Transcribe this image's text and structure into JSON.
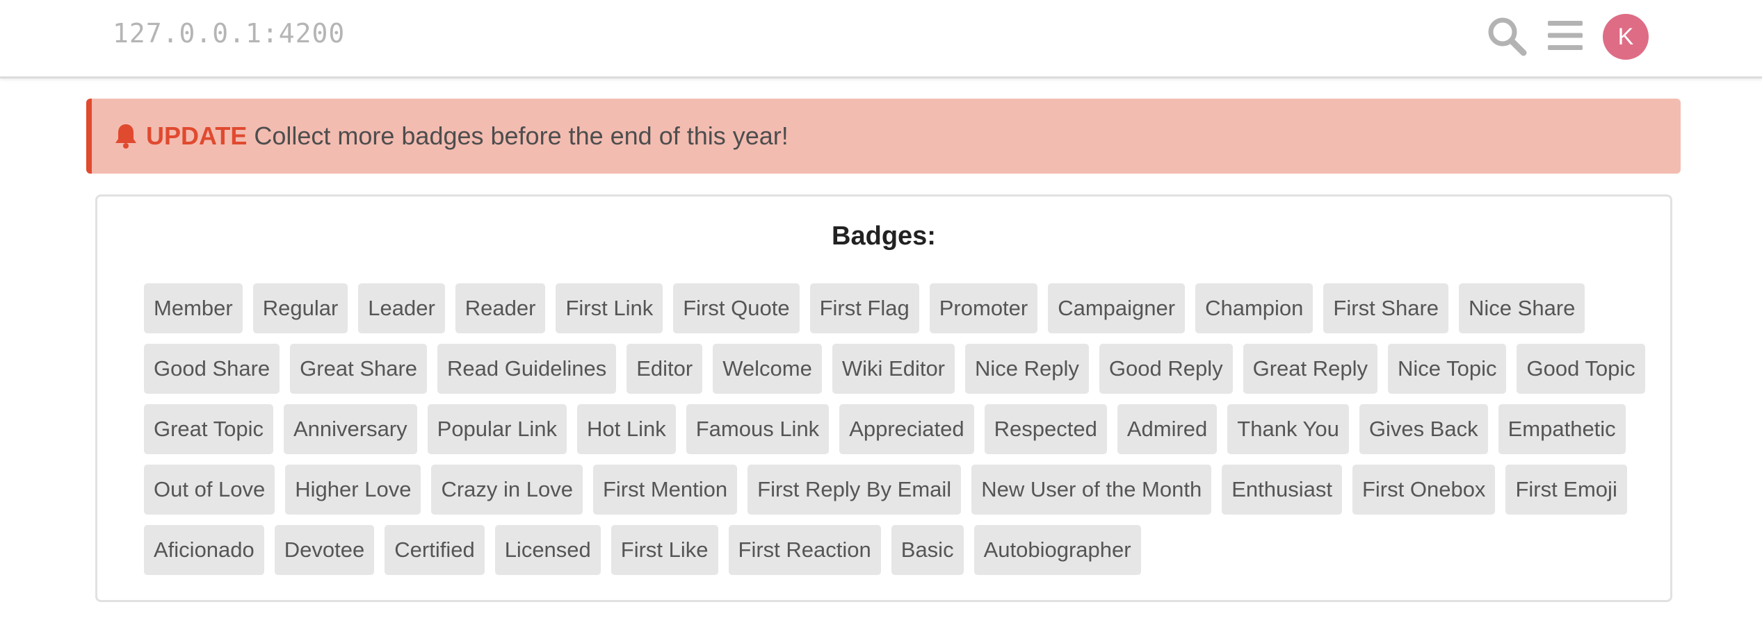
{
  "header": {
    "address": "127.0.0.1:4200",
    "avatar_initial": "K",
    "avatar_color": "#de6c85",
    "icons": [
      "search-icon",
      "menu-icon"
    ]
  },
  "alert": {
    "icon": "bell-icon",
    "tag": "UPDATE",
    "message": "Collect more badges before the end of this year!",
    "accent_color": "#e04a2f",
    "background_color": "#f3bcb1"
  },
  "badges_card": {
    "title": "Badges:",
    "items": [
      "Member",
      "Regular",
      "Leader",
      "Reader",
      "First Link",
      "First Quote",
      "First Flag",
      "Promoter",
      "Campaigner",
      "Champion",
      "First Share",
      "Nice Share",
      "Good Share",
      "Great Share",
      "Read Guidelines",
      "Editor",
      "Welcome",
      "Wiki Editor",
      "Nice Reply",
      "Good Reply",
      "Great Reply",
      "Nice Topic",
      "Good Topic",
      "Great Topic",
      "Anniversary",
      "Popular Link",
      "Hot Link",
      "Famous Link",
      "Appreciated",
      "Respected",
      "Admired",
      "Thank You",
      "Gives Back",
      "Empathetic",
      "Out of Love",
      "Higher Love",
      "Crazy in Love",
      "First Mention",
      "First Reply By Email",
      "New User of the Month",
      "Enthusiast",
      "First Onebox",
      "First Emoji",
      "Aficionado",
      "Devotee",
      "Certified",
      "Licensed",
      "First Like",
      "First Reaction",
      "Basic",
      "Autobiographer"
    ]
  }
}
